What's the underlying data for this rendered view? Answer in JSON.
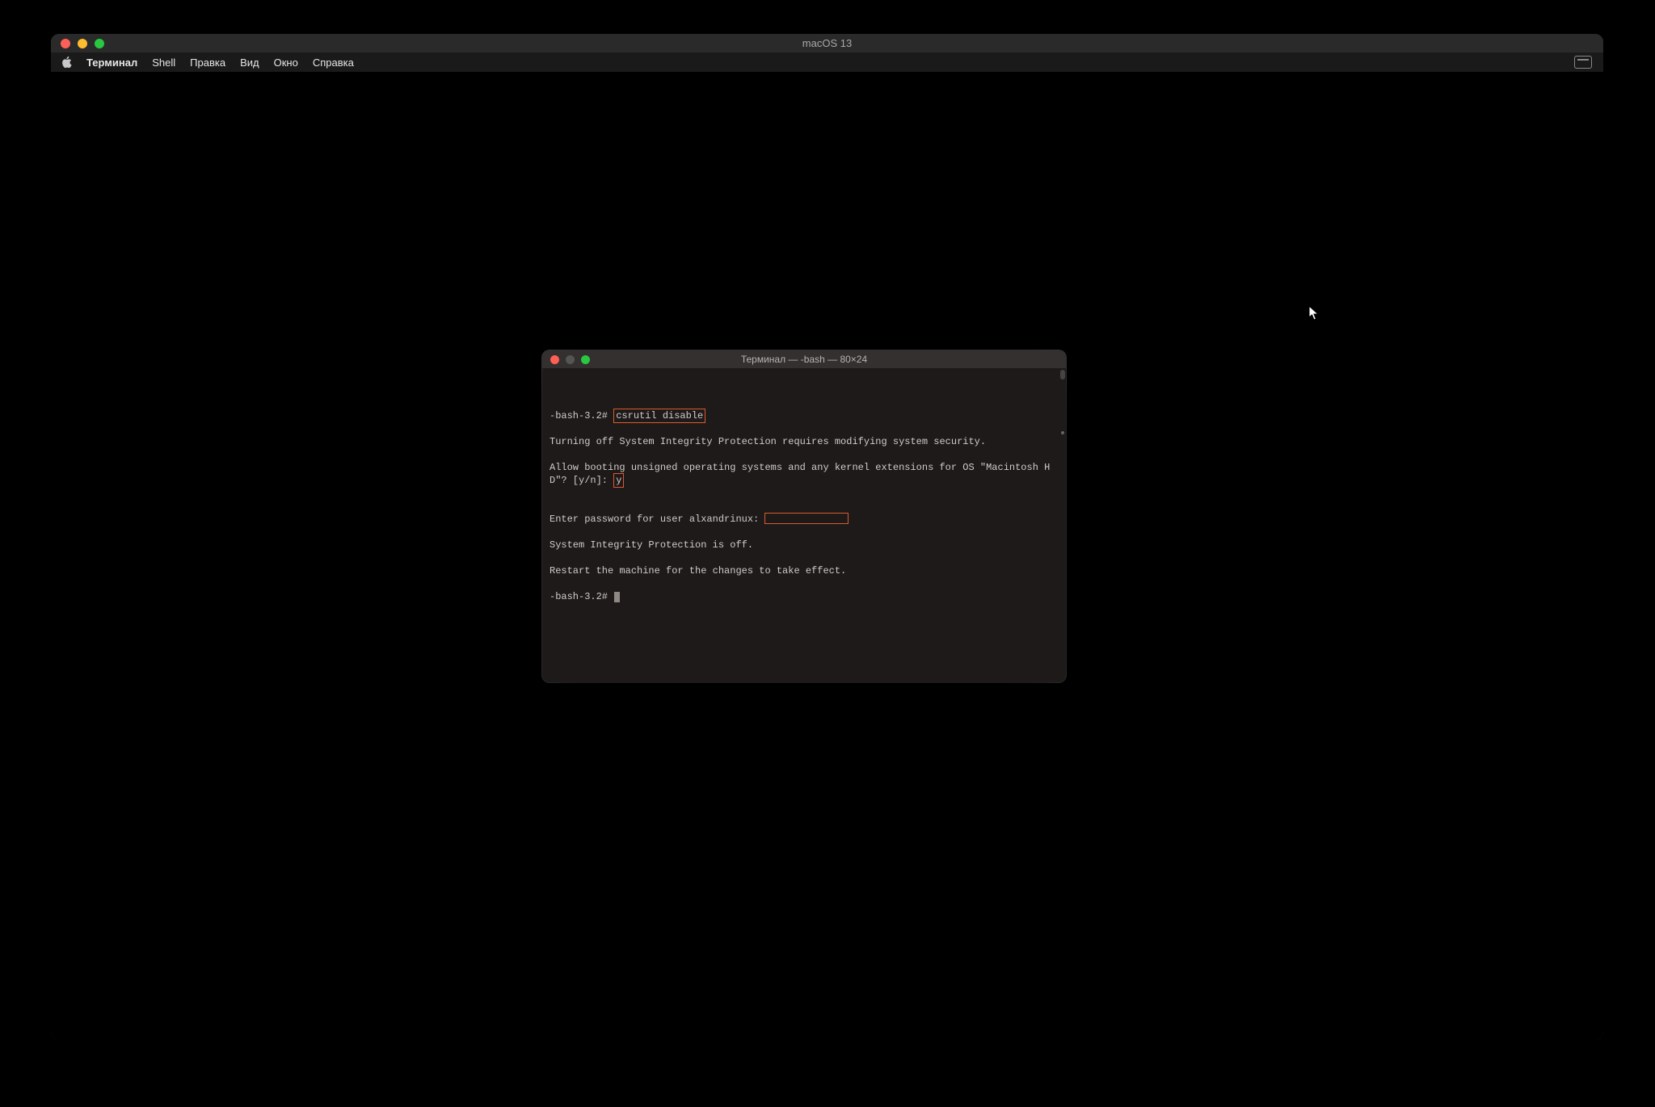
{
  "vm": {
    "title": "macOS 13",
    "menubar": {
      "app": "Терминал",
      "items": [
        "Shell",
        "Правка",
        "Вид",
        "Окно",
        "Справка"
      ]
    }
  },
  "terminal": {
    "title": "Терминал — -bash — 80×24",
    "prompt1_pre": "-bash-3.2# ",
    "cmd1": "csrutil disable",
    "out1": "Turning off System Integrity Protection requires modifying system security.",
    "out2a": "Allow booting unsigned operating systems and any kernel extensions for OS \"Macintosh HD\"? [y/n]: ",
    "ans1": "y",
    "out3": "",
    "out4_pre": "Enter password for user alxandrinux: ",
    "out5": "System Integrity Protection is off.",
    "out6": "Restart the machine for the changes to take effect.",
    "prompt2": "-bash-3.2# "
  }
}
